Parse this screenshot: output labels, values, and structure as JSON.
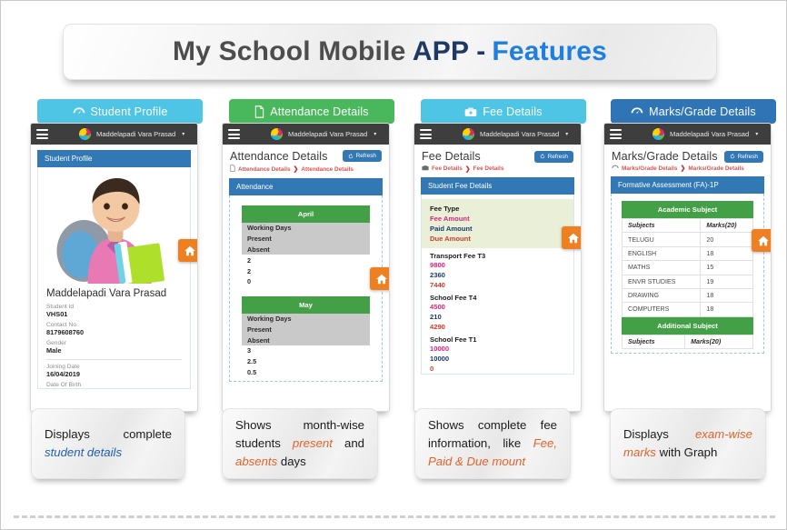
{
  "title": {
    "main": "My School Mobile ",
    "app": "APP -",
    "features": "Features"
  },
  "user": {
    "name": "Maddelapadi Vara Prasad",
    "caret": "▾"
  },
  "common": {
    "refresh_label": "Refresh",
    "breadcrumb_sep": "❯",
    "home_icon": "home-icon"
  },
  "cards": [
    {
      "header_label": "Student Profile",
      "header_icon": "speedometer-icon",
      "header_color": "#4ec5e4",
      "section_title": "Student Profile",
      "student": {
        "name": "Maddelapadi Vara Prasad",
        "fields": [
          {
            "label": "Student Id",
            "value": "VHS01"
          },
          {
            "label": "Contact No.",
            "value": "8179608760"
          },
          {
            "label": "Gender",
            "value": "Male"
          },
          {
            "label": "Joining Date",
            "value": "16/04/2019"
          },
          {
            "label": "Date Of Birth",
            "value": ""
          }
        ]
      },
      "caption": {
        "plain1": "Displays     complete ",
        "em": "student details",
        "plain2": "",
        "em_color": "blue"
      }
    },
    {
      "header_label": "Attendance Details",
      "header_icon": "document-icon",
      "header_color": "#49b85c",
      "page_title": "Attendance Details",
      "breadcrumb": {
        "icon": "document-icon",
        "first": "Attendance Details",
        "second": "Attendance Details"
      },
      "section_title": "Attendance",
      "months": [
        {
          "name": "April",
          "labels": [
            "Working Days",
            "Present",
            "Absent"
          ],
          "values": [
            "2",
            "2",
            "0"
          ]
        },
        {
          "name": "May",
          "labels": [
            "Working Days",
            "Present",
            "Absent"
          ],
          "values": [
            "3",
            "2.5",
            "0.5"
          ]
        }
      ],
      "caption": {
        "plain1": "Shows     month-wise students ",
        "em": "present",
        "plain2": " and ",
        "em2": "absents",
        "plain3": " days",
        "em_color": "orange"
      }
    },
    {
      "header_label": "Fee Details",
      "header_icon": "briefcase-icon",
      "header_color": "#4ec5e4",
      "page_title": "Fee Details",
      "breadcrumb": {
        "icon": "briefcase-icon",
        "first": "Fee Details",
        "second": "Fee Details"
      },
      "section_title": "Student Fee Details",
      "fee_labels": [
        {
          "text": "Fee Type",
          "color": "#1a1a1a"
        },
        {
          "text": "Fee Amount",
          "color": "#d6257e"
        },
        {
          "text": "Paid Amount",
          "color": "#1b3a6b"
        },
        {
          "text": "Due Amount",
          "color": "#d13a2c"
        }
      ],
      "fees": [
        {
          "type": "Transport Fee T3",
          "fee": "9800",
          "paid": "2360",
          "due": "7440"
        },
        {
          "type": "School Fee T4",
          "fee": "4500",
          "paid": "210",
          "due": "4290"
        },
        {
          "type": "School Fee T1",
          "fee": "10000",
          "paid": "10000",
          "due": "0"
        }
      ],
      "caption": {
        "plain1": "Shows  complete  fee information, like ",
        "em": "Fee, Paid & Due mount",
        "em_color": "orange"
      }
    },
    {
      "header_label": "Marks/Grade Details",
      "header_icon": "speedometer-icon",
      "header_color": "#2f74b5",
      "page_title": "Marks/Grade Details",
      "breadcrumb": {
        "icon": "speedometer-icon",
        "first": "Marks/Grade Details",
        "second": "Marks/Grade Details"
      },
      "section_title": "Formative Assessment (FA)-1P",
      "academic_header": "Academic Subject",
      "additional_header": "Additional Subject",
      "columns": [
        "Subjects",
        "Marks(20)"
      ],
      "rows": [
        {
          "subject": "TELUGU",
          "marks": "20"
        },
        {
          "subject": "ENGLISH",
          "marks": "18"
        },
        {
          "subject": "MATHS",
          "marks": "15"
        },
        {
          "subject": "ENVR STUDIES",
          "marks": "19"
        },
        {
          "subject": "DRAWING",
          "marks": "18"
        },
        {
          "subject": "COMPUTERS",
          "marks": "18"
        }
      ],
      "caption": {
        "plain1": "Displays     ",
        "em": "exam-wise marks",
        "plain2": " with Graph",
        "em_color": "orange"
      }
    }
  ]
}
